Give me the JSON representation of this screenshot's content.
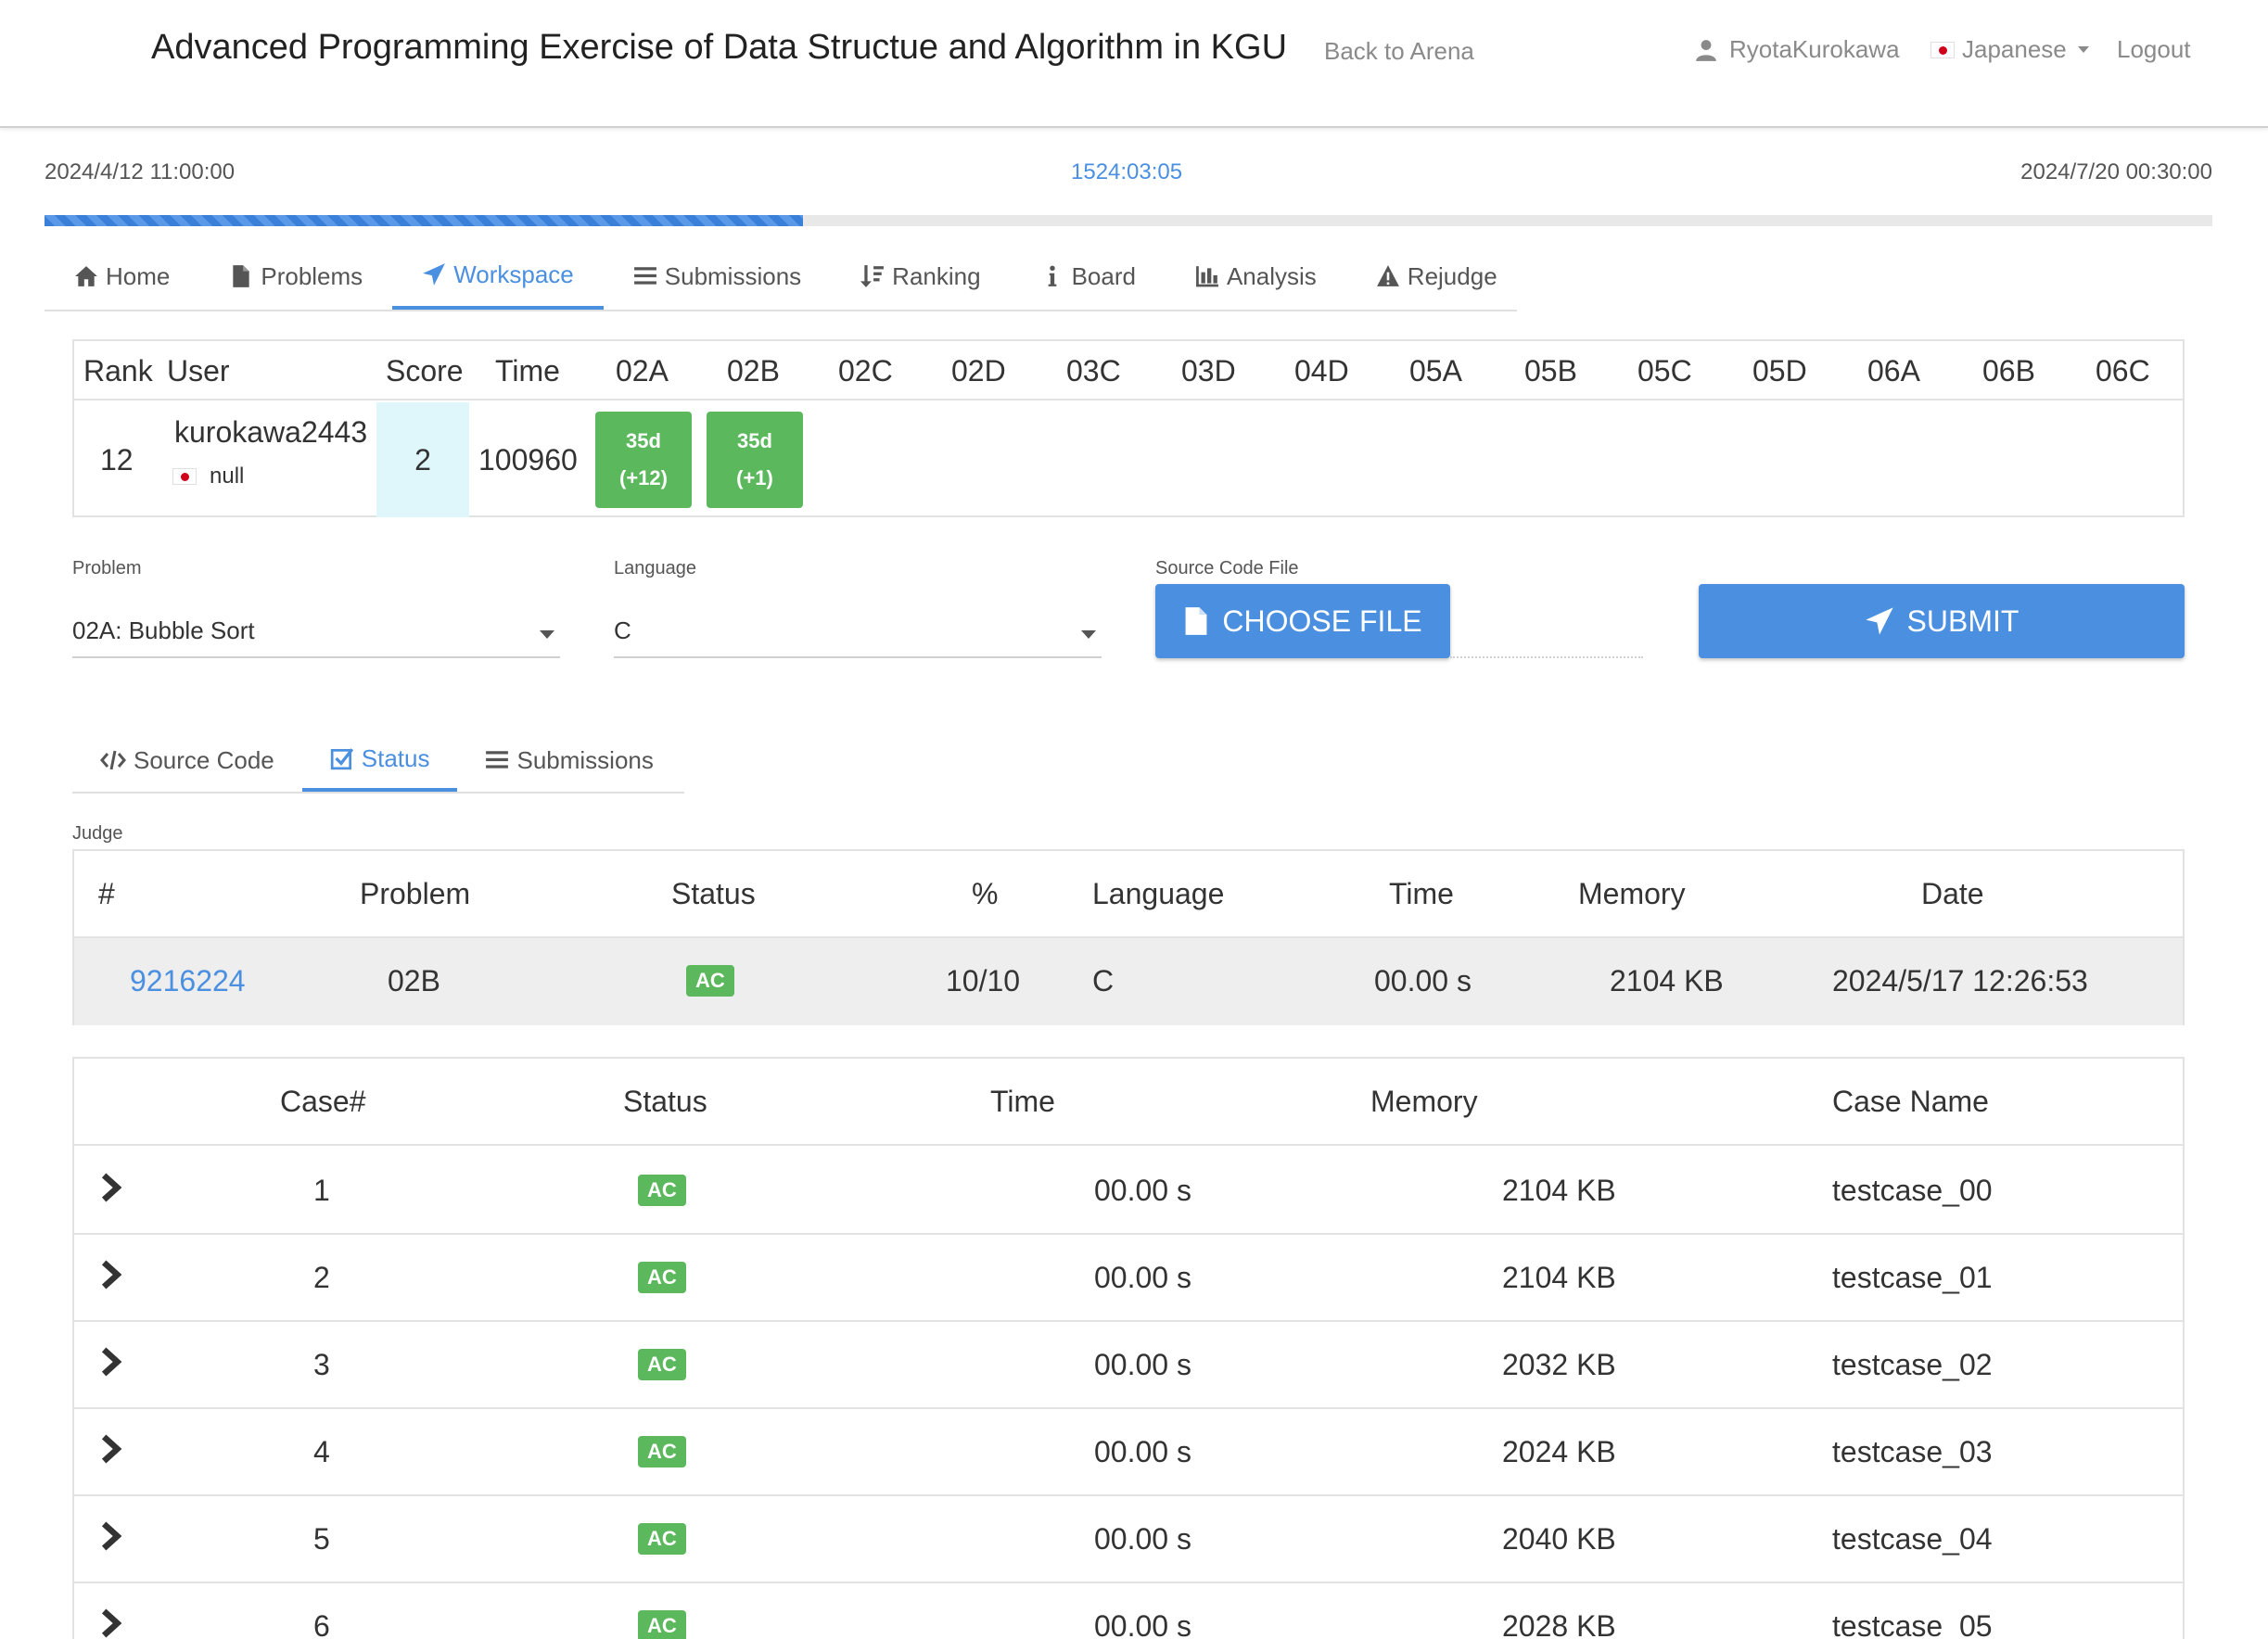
{
  "header": {
    "title": "Advanced Programming Exercise of Data Structue and Algorithm in KGU",
    "back_link": "Back to Arena",
    "user": "RyotaKurokawa",
    "language": "Japanese",
    "logout": "Logout"
  },
  "timer": {
    "start": "2024/4/12 11:00:00",
    "remaining": "1524:03:05",
    "end": "2024/7/20 00:30:00",
    "progress_fraction": 0.35
  },
  "nav": {
    "items": [
      {
        "label": "Home",
        "icon": "home-icon"
      },
      {
        "label": "Problems",
        "icon": "file-icon"
      },
      {
        "label": "Workspace",
        "icon": "send-icon",
        "active": true
      },
      {
        "label": "Submissions",
        "icon": "list-icon"
      },
      {
        "label": "Ranking",
        "icon": "sort-icon"
      },
      {
        "label": "Board",
        "icon": "info-icon"
      },
      {
        "label": "Analysis",
        "icon": "bar-chart-icon"
      },
      {
        "label": "Rejudge",
        "icon": "warning-icon"
      }
    ]
  },
  "ranking": {
    "headers": [
      "Rank",
      "User",
      "Score",
      "Time",
      "02A",
      "02B",
      "02C",
      "02D",
      "03C",
      "03D",
      "04D",
      "05A",
      "05B",
      "05C",
      "05D",
      "06A",
      "06B",
      "06C"
    ],
    "row": {
      "rank": "12",
      "user": "kurokawa2443",
      "affiliation": "null",
      "score": "2",
      "time": "100960",
      "solved": [
        {
          "problem": "02A",
          "line1": "35d",
          "line2": "(+12)"
        },
        {
          "problem": "02B",
          "line1": "35d",
          "line2": "(+1)"
        }
      ]
    }
  },
  "form": {
    "problem_label": "Problem",
    "problem_value": "02A: Bubble Sort",
    "language_label": "Language",
    "language_value": "C",
    "file_label": "Source Code File",
    "choose_file": "CHOOSE FILE",
    "submit": "SUBMIT"
  },
  "subnav": {
    "items": [
      {
        "label": "Source Code",
        "icon": "code-icon"
      },
      {
        "label": "Status",
        "icon": "checkbox-icon",
        "active": true
      },
      {
        "label": "Submissions",
        "icon": "list-icon"
      }
    ]
  },
  "judge": {
    "label": "Judge",
    "headers": [
      "#",
      "Problem",
      "Status",
      "%",
      "Language",
      "Time",
      "Memory",
      "Date"
    ],
    "row": {
      "id": "9216224",
      "problem": "02B",
      "status": "AC",
      "percent": "10/10",
      "language": "C",
      "time": "00.00 s",
      "memory": "2104 KB",
      "date": "2024/5/17 12:26:53"
    }
  },
  "cases": {
    "headers": [
      "Case#",
      "Status",
      "Time",
      "Memory",
      "Case Name"
    ],
    "rows": [
      {
        "num": "1",
        "status": "AC",
        "time": "00.00 s",
        "memory": "2104 KB",
        "name": "testcase_00"
      },
      {
        "num": "2",
        "status": "AC",
        "time": "00.00 s",
        "memory": "2104 KB",
        "name": "testcase_01"
      },
      {
        "num": "3",
        "status": "AC",
        "time": "00.00 s",
        "memory": "2032 KB",
        "name": "testcase_02"
      },
      {
        "num": "4",
        "status": "AC",
        "time": "00.00 s",
        "memory": "2024 KB",
        "name": "testcase_03"
      },
      {
        "num": "5",
        "status": "AC",
        "time": "00.00 s",
        "memory": "2040 KB",
        "name": "testcase_04"
      },
      {
        "num": "6",
        "status": "AC",
        "time": "00.00 s",
        "memory": "2028 KB",
        "name": "testcase_05"
      }
    ]
  }
}
